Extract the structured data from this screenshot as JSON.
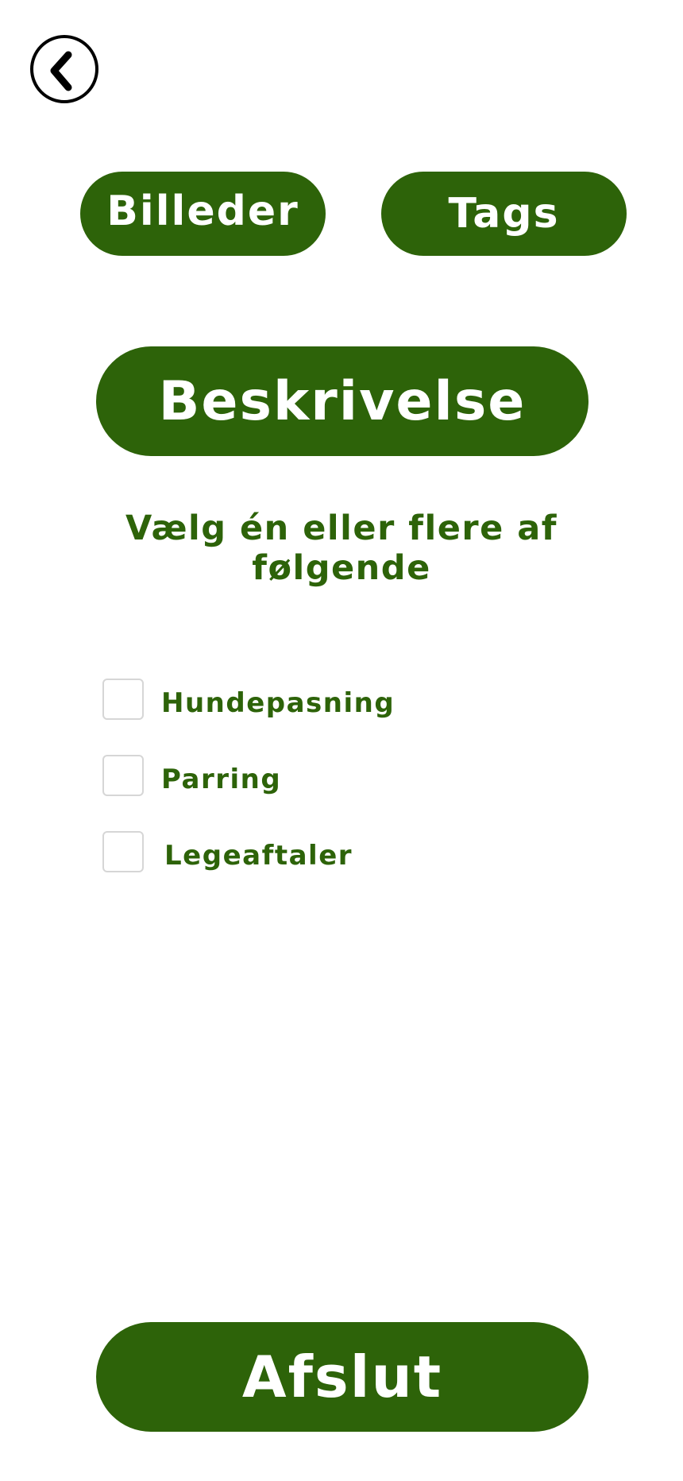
{
  "colors": {
    "accent": "#2d6309",
    "button_text": "#ffffff",
    "background": "#ffffff"
  },
  "header": {
    "back_icon": "chevron-left-icon"
  },
  "tabs": [
    {
      "label": "Billeder"
    },
    {
      "label": "Tags"
    }
  ],
  "section": {
    "title": "Beskrivelse",
    "instruction_line1": "Vælg én eller flere af",
    "instruction_line2": "følgende"
  },
  "options": [
    {
      "label": "Hundepasning",
      "checked": false
    },
    {
      "label": "Parring",
      "checked": false
    },
    {
      "label": "Legeaftaler",
      "checked": false
    }
  ],
  "footer": {
    "finish_label": "Afslut"
  }
}
